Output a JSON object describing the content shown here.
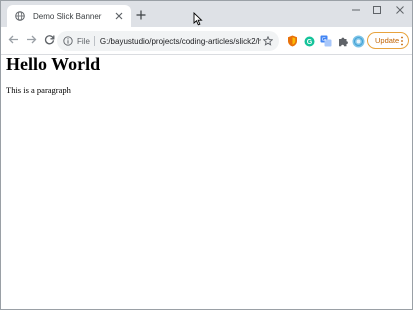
{
  "tab": {
    "title": "Demo Slick Banner",
    "favicon": "globe-icon"
  },
  "window_controls": [
    "minimize-icon",
    "maximize-icon",
    "close-icon"
  ],
  "toolbar": {
    "back_icon": "arrow-left-icon",
    "forward_icon": "arrow-right-icon",
    "reload_icon": "reload-icon",
    "scheme_label": "File",
    "url": "G:/bayustudio/projects/coding-articles/slick2/htm...",
    "update_label": "Update",
    "update_color": "#e8a33d",
    "extensions": [
      "extension-shield-icon",
      "extension-green-circle-icon",
      "extension-translate-icon",
      "extensions-puzzle-icon",
      "profile-avatar-icon"
    ]
  },
  "page": {
    "heading": "Hello World",
    "paragraph": "This is a paragraph"
  }
}
